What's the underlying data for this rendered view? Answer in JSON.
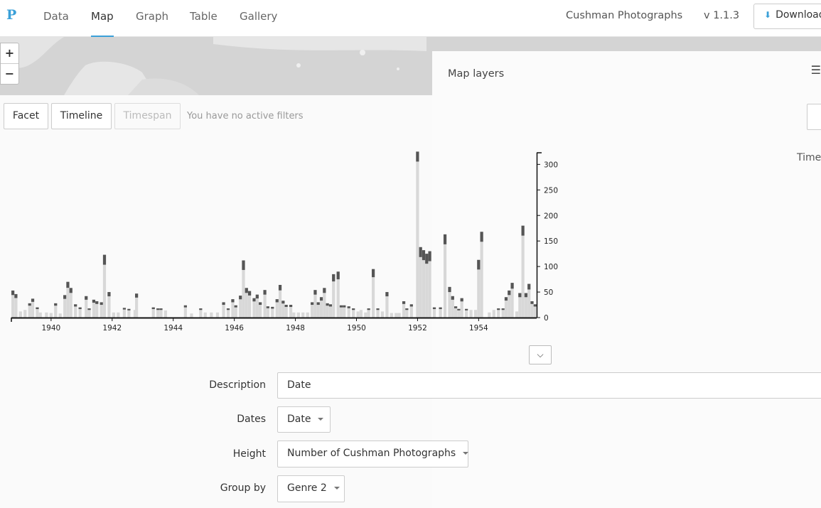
{
  "nav": {
    "logo": "P",
    "tabs": [
      {
        "label": "Data",
        "active": false
      },
      {
        "label": "Map",
        "active": true
      },
      {
        "label": "Graph",
        "active": false
      },
      {
        "label": "Table",
        "active": false
      },
      {
        "label": "Gallery",
        "active": false
      }
    ],
    "app_title": "Cushman Photographs",
    "version": "v 1.1.3",
    "download_label": "Download"
  },
  "map": {
    "zoom_in": "+",
    "zoom_out": "−",
    "layers_title": "Map layers"
  },
  "filters": {
    "facet": "Facet",
    "timeline": "Timeline",
    "timespan": "Timespan",
    "status": "You have no active filters"
  },
  "right_label": "Timel",
  "chart_data": {
    "type": "bar",
    "stacked": true,
    "x_ticks": [
      "1940",
      "1942",
      "1944",
      "1946",
      "1948",
      "1950",
      "1952",
      "1954"
    ],
    "y_ticks": [
      "0",
      "50",
      "100",
      "150",
      "200",
      "250",
      "300"
    ],
    "ylim": [
      0,
      320
    ],
    "bins": [
      {
        "x": 1938.7,
        "y": 53
      },
      {
        "x": 1938.8,
        "y": 46
      },
      {
        "x": 1938.95,
        "y": 12
      },
      {
        "x": 1939.1,
        "y": 15
      },
      {
        "x": 1939.25,
        "y": 28
      },
      {
        "x": 1939.35,
        "y": 37
      },
      {
        "x": 1939.5,
        "y": 20
      },
      {
        "x": 1939.6,
        "y": 10
      },
      {
        "x": 1939.8,
        "y": 10
      },
      {
        "x": 1939.95,
        "y": 9
      },
      {
        "x": 1940.1,
        "y": 28
      },
      {
        "x": 1940.25,
        "y": 8
      },
      {
        "x": 1940.4,
        "y": 44
      },
      {
        "x": 1940.5,
        "y": 70
      },
      {
        "x": 1940.6,
        "y": 58
      },
      {
        "x": 1940.75,
        "y": 26
      },
      {
        "x": 1940.9,
        "y": 20
      },
      {
        "x": 1941.1,
        "y": 42
      },
      {
        "x": 1941.2,
        "y": 18
      },
      {
        "x": 1941.35,
        "y": 35
      },
      {
        "x": 1941.45,
        "y": 32
      },
      {
        "x": 1941.6,
        "y": 30
      },
      {
        "x": 1941.7,
        "y": 123
      },
      {
        "x": 1941.85,
        "y": 50
      },
      {
        "x": 1942.0,
        "y": 10
      },
      {
        "x": 1942.15,
        "y": 10
      },
      {
        "x": 1942.35,
        "y": 19
      },
      {
        "x": 1942.5,
        "y": 17
      },
      {
        "x": 1942.7,
        "y": 15
      },
      {
        "x": 1942.75,
        "y": 47
      },
      {
        "x": 1943.3,
        "y": 20
      },
      {
        "x": 1943.45,
        "y": 18
      },
      {
        "x": 1943.55,
        "y": 18
      },
      {
        "x": 1943.7,
        "y": 14
      },
      {
        "x": 1944.35,
        "y": 24
      },
      {
        "x": 1944.55,
        "y": 8
      },
      {
        "x": 1944.85,
        "y": 18
      },
      {
        "x": 1945.0,
        "y": 10
      },
      {
        "x": 1945.2,
        "y": 10
      },
      {
        "x": 1945.4,
        "y": 10
      },
      {
        "x": 1945.6,
        "y": 30
      },
      {
        "x": 1945.75,
        "y": 18
      },
      {
        "x": 1945.9,
        "y": 36
      },
      {
        "x": 1946.0,
        "y": 24
      },
      {
        "x": 1946.15,
        "y": 43
      },
      {
        "x": 1946.25,
        "y": 112
      },
      {
        "x": 1946.35,
        "y": 58
      },
      {
        "x": 1946.45,
        "y": 52
      },
      {
        "x": 1946.6,
        "y": 38
      },
      {
        "x": 1946.7,
        "y": 45
      },
      {
        "x": 1946.8,
        "y": 30
      },
      {
        "x": 1946.95,
        "y": 54
      },
      {
        "x": 1947.05,
        "y": 22
      },
      {
        "x": 1947.2,
        "y": 21
      },
      {
        "x": 1947.35,
        "y": 36
      },
      {
        "x": 1947.45,
        "y": 64
      },
      {
        "x": 1947.55,
        "y": 33
      },
      {
        "x": 1947.65,
        "y": 25
      },
      {
        "x": 1947.8,
        "y": 25
      },
      {
        "x": 1947.9,
        "y": 10
      },
      {
        "x": 1948.05,
        "y": 10
      },
      {
        "x": 1948.2,
        "y": 10
      },
      {
        "x": 1948.35,
        "y": 10
      },
      {
        "x": 1948.5,
        "y": 30
      },
      {
        "x": 1948.6,
        "y": 54
      },
      {
        "x": 1948.7,
        "y": 30
      },
      {
        "x": 1948.8,
        "y": 40
      },
      {
        "x": 1948.9,
        "y": 58
      },
      {
        "x": 1949.0,
        "y": 28
      },
      {
        "x": 1949.1,
        "y": 26
      },
      {
        "x": 1949.2,
        "y": 85
      },
      {
        "x": 1949.35,
        "y": 90
      },
      {
        "x": 1949.45,
        "y": 24
      },
      {
        "x": 1949.55,
        "y": 24
      },
      {
        "x": 1949.7,
        "y": 22
      },
      {
        "x": 1949.85,
        "y": 18
      },
      {
        "x": 1950.0,
        "y": 12
      },
      {
        "x": 1950.1,
        "y": 15
      },
      {
        "x": 1950.25,
        "y": 10
      },
      {
        "x": 1950.35,
        "y": 18
      },
      {
        "x": 1950.5,
        "y": 95
      },
      {
        "x": 1950.65,
        "y": 18
      },
      {
        "x": 1950.8,
        "y": 12
      },
      {
        "x": 1950.95,
        "y": 50
      },
      {
        "x": 1951.1,
        "y": 9
      },
      {
        "x": 1951.25,
        "y": 9
      },
      {
        "x": 1951.35,
        "y": 9
      },
      {
        "x": 1951.5,
        "y": 32
      },
      {
        "x": 1951.6,
        "y": 18
      },
      {
        "x": 1951.75,
        "y": 26
      },
      {
        "x": 1951.95,
        "y": 325
      },
      {
        "x": 1952.05,
        "y": 138
      },
      {
        "x": 1952.15,
        "y": 132
      },
      {
        "x": 1952.25,
        "y": 125
      },
      {
        "x": 1952.35,
        "y": 130
      },
      {
        "x": 1952.5,
        "y": 20
      },
      {
        "x": 1952.7,
        "y": 20
      },
      {
        "x": 1952.85,
        "y": 163
      },
      {
        "x": 1953.0,
        "y": 60
      },
      {
        "x": 1953.1,
        "y": 42
      },
      {
        "x": 1953.2,
        "y": 22
      },
      {
        "x": 1953.3,
        "y": 17
      },
      {
        "x": 1953.4,
        "y": 38
      },
      {
        "x": 1953.55,
        "y": 17
      },
      {
        "x": 1953.7,
        "y": 15
      },
      {
        "x": 1953.85,
        "y": 15
      },
      {
        "x": 1953.95,
        "y": 113
      },
      {
        "x": 1954.05,
        "y": 168
      },
      {
        "x": 1954.3,
        "y": 10
      },
      {
        "x": 1954.45,
        "y": 15
      },
      {
        "x": 1954.6,
        "y": 18
      },
      {
        "x": 1954.75,
        "y": 18
      },
      {
        "x": 1954.85,
        "y": 40
      },
      {
        "x": 1954.95,
        "y": 53
      },
      {
        "x": 1955.05,
        "y": 68
      },
      {
        "x": 1955.2,
        "y": 12
      },
      {
        "x": 1955.3,
        "y": 48
      },
      {
        "x": 1955.4,
        "y": 180
      },
      {
        "x": 1955.5,
        "y": 48
      },
      {
        "x": 1955.6,
        "y": 66
      },
      {
        "x": 1955.7,
        "y": 32
      },
      {
        "x": 1955.8,
        "y": 26
      }
    ]
  },
  "form": {
    "description_label": "Description",
    "description_value": "Date",
    "dates_label": "Dates",
    "dates_value": "Date",
    "height_label": "Height",
    "height_value": "Number of Cushman Photographs",
    "groupby_label": "Group by",
    "groupby_value": "Genre 2"
  }
}
